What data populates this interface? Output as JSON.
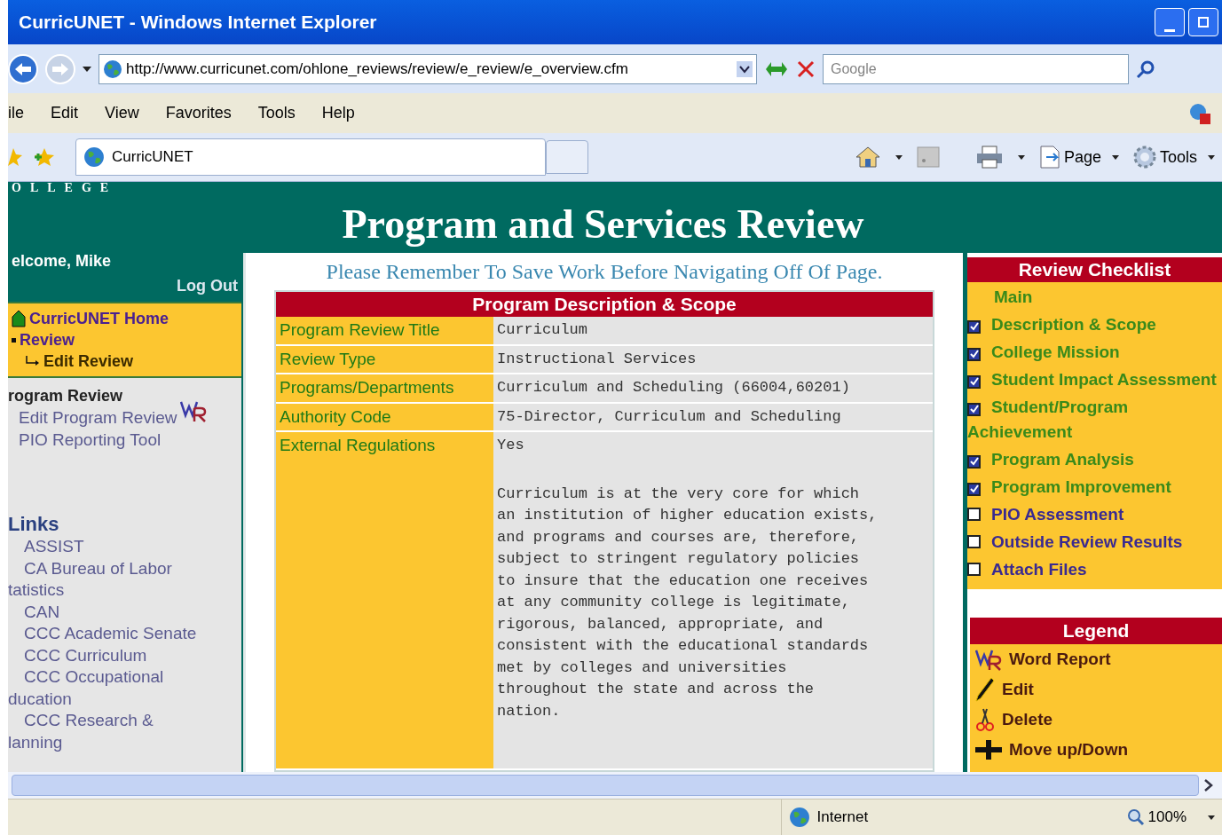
{
  "window": {
    "title": "CurricUNET - Windows Internet Explorer"
  },
  "address_bar": {
    "url": "http://www.curricunet.com/ohlone_reviews/review/e_review/e_overview.cfm"
  },
  "search": {
    "placeholder": "Google"
  },
  "menu": [
    "ile",
    "Edit",
    "View",
    "Favorites",
    "Tools",
    "Help"
  ],
  "tabs": [
    {
      "label": "CurricUNET",
      "selected": true
    }
  ],
  "command_bar": [
    "Page",
    "Tools"
  ],
  "page": {
    "college_text": "OLLEGE",
    "title": "Program and Services Review",
    "welcome": "elcome, Mike",
    "logout": "Log Out",
    "nav": [
      {
        "kind": "home",
        "label": "CurricUNET Home"
      },
      {
        "kind": "bullet",
        "label": "Review"
      },
      {
        "kind": "sub",
        "label": "Edit Review"
      }
    ],
    "section_heading": "rogram Review",
    "section_links": [
      {
        "label": "Edit Program Review",
        "word_report": true
      },
      {
        "label": "PIO Reporting Tool",
        "word_report": false
      }
    ],
    "links_heading": "Links",
    "links": [
      {
        "lines": [
          "ASSIST"
        ]
      },
      {
        "lines": [
          "CA Bureau of Labor",
          "tatistics"
        ]
      },
      {
        "lines": [
          "CAN"
        ]
      },
      {
        "lines": [
          "CCC Academic Senate"
        ]
      },
      {
        "lines": [
          "CCC Curriculum"
        ]
      },
      {
        "lines": [
          "CCC Occupational",
          "ducation"
        ]
      },
      {
        "lines": [
          "CCC Research &",
          "lanning"
        ]
      }
    ],
    "notice": "Please Remember To Save Work Before Navigating Off Of Page.",
    "table": {
      "heading": "Program Description & Scope",
      "rows": [
        {
          "label": "Program Review Title",
          "value": "Curriculum"
        },
        {
          "label": "Review Type",
          "value": "Instructional Services"
        },
        {
          "label": "Programs/Departments",
          "value": "Curriculum and Scheduling (66004,60201)"
        },
        {
          "label": "Authority Code",
          "value": "75-Director, Curriculum and Scheduling"
        },
        {
          "label": "External Regulations",
          "value": "Yes",
          "description": "Curriculum is at the very core for which an institution of higher education exists, and programs and courses are, therefore, subject to stringent regulatory policies to insure that the education one receives at any community college is legitimate, rigorous, balanced, appropriate, and consistent with the educational standards met by colleges and universities throughout the state and across the nation."
        }
      ]
    },
    "checklist": {
      "heading": "Review Checklist",
      "items": [
        {
          "kind": "plain",
          "label": "Main"
        },
        {
          "kind": "checkbox",
          "label": "Description & Scope",
          "checked": true
        },
        {
          "kind": "checkbox",
          "label": "College Mission",
          "checked": true
        },
        {
          "kind": "checkbox",
          "label": "Student Impact Assessment",
          "checked": true
        },
        {
          "kind": "checkbox",
          "label": "Student/Program Achievement",
          "checked": true
        },
        {
          "kind": "checkbox",
          "label": "Program Analysis",
          "checked": true
        },
        {
          "kind": "checkbox",
          "label": "Program Improvement",
          "checked": true
        },
        {
          "kind": "checkbox",
          "label": "PIO Assessment",
          "checked": false
        },
        {
          "kind": "checkbox",
          "label": "Outside Review Results",
          "checked": false
        },
        {
          "kind": "checkbox",
          "label": "Attach Files",
          "checked": false
        }
      ]
    },
    "legend": {
      "heading": "Legend",
      "items": [
        {
          "kind": "word-report",
          "label": "Word Report"
        },
        {
          "kind": "edit",
          "label": "Edit"
        },
        {
          "kind": "delete",
          "label": "Delete"
        },
        {
          "kind": "move",
          "label": "Move up/Down"
        }
      ]
    }
  },
  "status_bar": {
    "zone": "Internet",
    "zoom": "100%"
  }
}
